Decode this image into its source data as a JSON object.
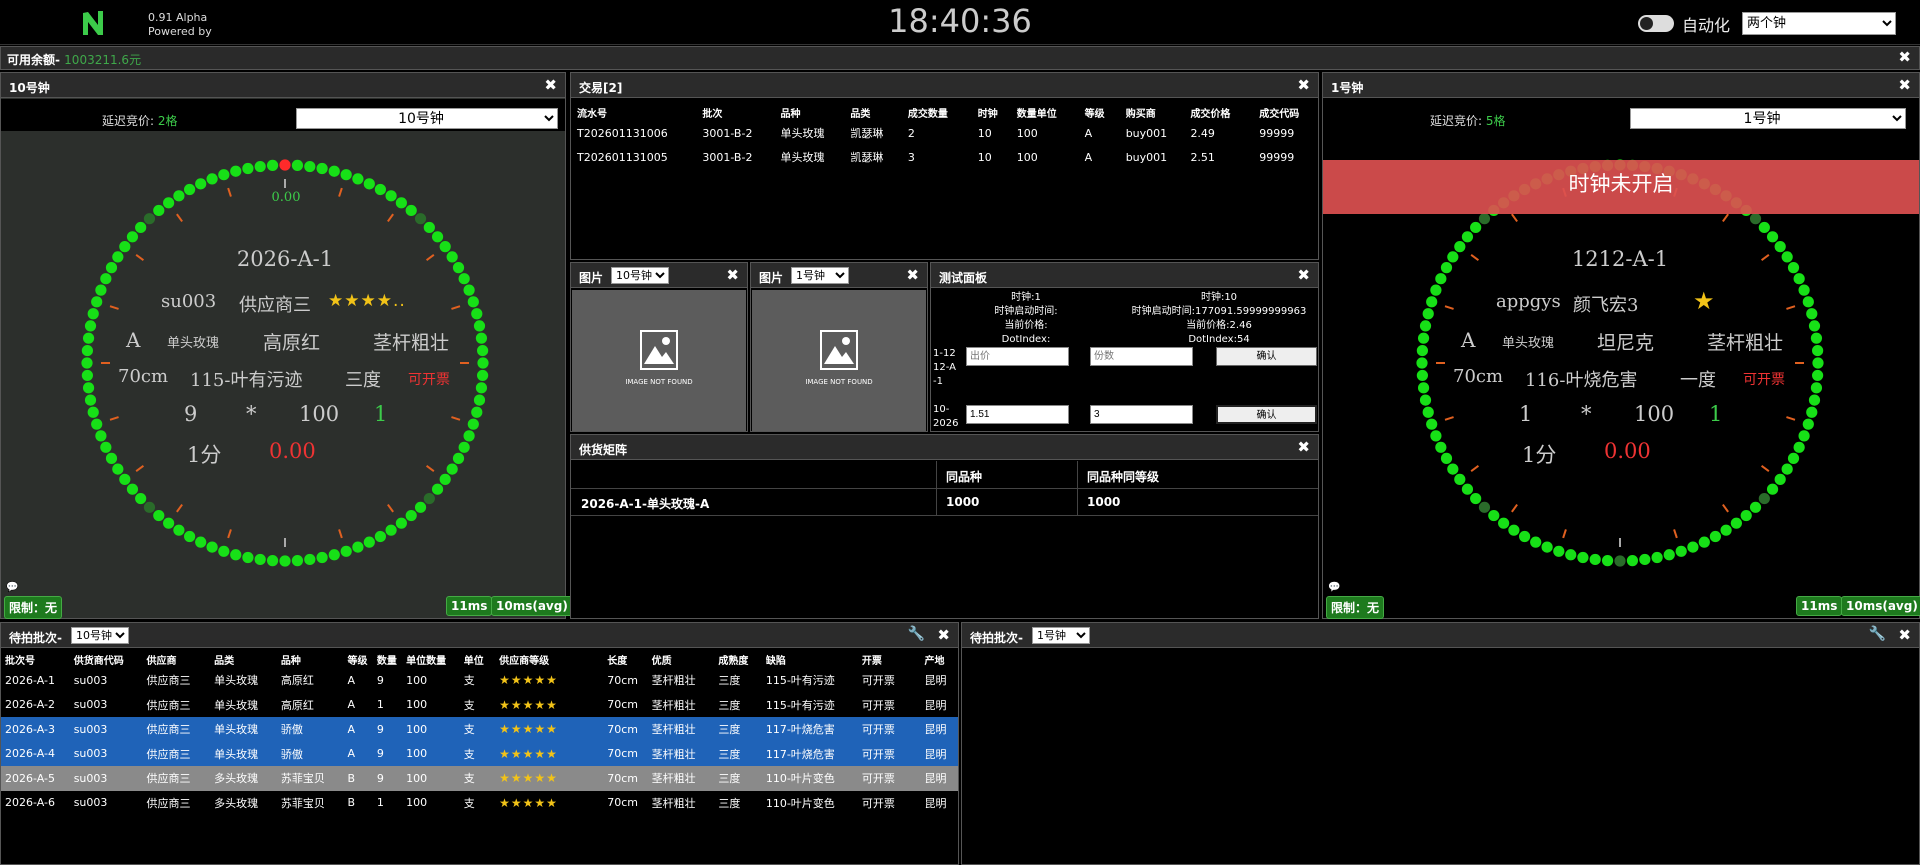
{
  "header": {
    "version": "0.91 Alpha",
    "powered": "Powered by",
    "clock": "18:40:36",
    "auto_label": "自动化",
    "mode_value": "两个钟",
    "mode_options": [
      "两个钟"
    ]
  },
  "balance": {
    "label": "可用余额-",
    "value": "1003211.6元"
  },
  "clock10": {
    "title": "10号钟",
    "delay_label": "延迟竞价:",
    "delay_value": "2格",
    "select": "10号钟",
    "price_pointer": "0.00",
    "lot": "2026-A-1",
    "supplier_code": "su003",
    "supplier": "供应商三",
    "stars": "★★★★..",
    "grade": "A",
    "category": "单头玫瑰",
    "variety": "高原红",
    "quality": "茎杆粗壮",
    "length": "70cm",
    "defect": "115-叶有污迹",
    "ripeness": "三度",
    "invoice": "可开票",
    "qty": "9",
    "times": "*",
    "unit_qty": "100",
    "bought": "1",
    "unit": "1分",
    "price": "0.00",
    "limit": "限制：无",
    "lat": "11ms",
    "lat_avg": "10ms(avg)"
  },
  "clock1": {
    "title": "1号钟",
    "delay_label": "延迟竞价:",
    "delay_value": "5格",
    "select": "1号钟",
    "banner": "时钟未开启",
    "lot": "1212-A-1",
    "supplier_code": "appgys",
    "supplier": "颜飞宏3",
    "stars": "★",
    "grade": "A",
    "category": "单头玫瑰",
    "variety": "坦尼克",
    "quality": "茎杆粗壮",
    "length": "70cm",
    "defect": "116-叶烧危害",
    "ripeness": "一度",
    "invoice": "可开票",
    "qty": "1",
    "times": "*",
    "unit_qty": "100",
    "bought": "1",
    "unit": "1分",
    "price": "0.00",
    "limit": "限制：无",
    "lat": "11ms",
    "lat_avg": "10ms(avg)"
  },
  "trades": {
    "title": "交易[2]",
    "columns": [
      "流水号",
      "批次",
      "品种",
      "品类",
      "成交数量",
      "时钟",
      "数量单位",
      "等级",
      "购买商",
      "成交价格",
      "成交代码"
    ],
    "rows": [
      [
        "T202601131006",
        "3001-B-2",
        "单头玫瑰",
        "凯瑟琳",
        "2",
        "10",
        "100",
        "A",
        "buy001",
        "2.49",
        "99999"
      ],
      [
        "T202601131005",
        "3001-B-2",
        "单头玫瑰",
        "凯瑟琳",
        "3",
        "10",
        "100",
        "A",
        "buy001",
        "2.51",
        "99999"
      ]
    ]
  },
  "pic1": {
    "title": "图片",
    "select": "10号钟",
    "not_found": "IMAGE NOT FOUND"
  },
  "pic2": {
    "title": "图片",
    "select": "1号钟",
    "not_found": "IMAGE NOT FOUND"
  },
  "test": {
    "title": "测试面板",
    "left": {
      "clock": "时钟:1",
      "start": "时钟启动时间:",
      "price": "当前价格:",
      "dot": "DotIndex:"
    },
    "right": {
      "clock": "时钟:10",
      "start": "时钟启动时间:177091.59999999963",
      "price": "当前价格:2.46",
      "dot": "DotIndex:54"
    },
    "row1_label": "1-1212-A-1",
    "row2_label": "10-2026-",
    "bid_placeholder": "出价",
    "qty_placeholder": "份数",
    "confirm": "确认",
    "bid_value": "1.51",
    "qty_value": "3"
  },
  "supply": {
    "title": "供货矩阵",
    "col1": "",
    "col2": "同品种",
    "col3": "同品种同等级",
    "row": [
      "2026-A-1-单头玫瑰-A",
      "1000",
      "1000"
    ]
  },
  "pending1": {
    "title": "待拍批次-",
    "select": "10号钟",
    "columns": [
      "批次号",
      "供货商代码",
      "供应商",
      "品类",
      "品种",
      "等级",
      "数量",
      "单位数量",
      "单位",
      "供应商等级",
      "长度",
      "优质",
      "成熟度",
      "缺陷",
      "开票",
      "产地"
    ],
    "rows": [
      {
        "c": [
          "2026-A-1",
          "su003",
          "供应商三",
          "单头玫瑰",
          "高原红",
          "A",
          "9",
          "100",
          "支",
          "★★★★★",
          "70cm",
          "茎杆粗壮",
          "三度",
          "115-叶有污迹",
          "可开票",
          "昆明"
        ],
        "style": "normal"
      },
      {
        "c": [
          "2026-A-2",
          "su003",
          "供应商三",
          "单头玫瑰",
          "高原红",
          "A",
          "1",
          "100",
          "支",
          "★★★★★",
          "70cm",
          "茎杆粗壮",
          "三度",
          "115-叶有污迹",
          "可开票",
          "昆明"
        ],
        "style": "normal"
      },
      {
        "c": [
          "2026-A-3",
          "su003",
          "供应商三",
          "单头玫瑰",
          "骄傲",
          "A",
          "9",
          "100",
          "支",
          "★★★★★",
          "70cm",
          "茎杆粗壮",
          "三度",
          "117-叶烧危害",
          "可开票",
          "昆明"
        ],
        "style": "blue"
      },
      {
        "c": [
          "2026-A-4",
          "su003",
          "供应商三",
          "单头玫瑰",
          "骄傲",
          "A",
          "9",
          "100",
          "支",
          "★★★★★",
          "70cm",
          "茎杆粗壮",
          "三度",
          "117-叶烧危害",
          "可开票",
          "昆明"
        ],
        "style": "blue"
      },
      {
        "c": [
          "2026-A-5",
          "su003",
          "供应商三",
          "多头玫瑰",
          "苏菲宝贝",
          "B",
          "9",
          "100",
          "支",
          "★★★★★",
          "70cm",
          "茎杆粗壮",
          "三度",
          "110-叶片变色",
          "可开票",
          "昆明"
        ],
        "style": "gray"
      },
      {
        "c": [
          "2026-A-6",
          "su003",
          "供应商三",
          "多头玫瑰",
          "苏菲宝贝",
          "B",
          "1",
          "100",
          "支",
          "★★★★★",
          "70cm",
          "茎杆粗壮",
          "三度",
          "110-叶片变色",
          "可开票",
          "昆明"
        ],
        "style": "normal"
      }
    ]
  },
  "pending2": {
    "title": "待拍批次-",
    "select": "1号钟"
  }
}
